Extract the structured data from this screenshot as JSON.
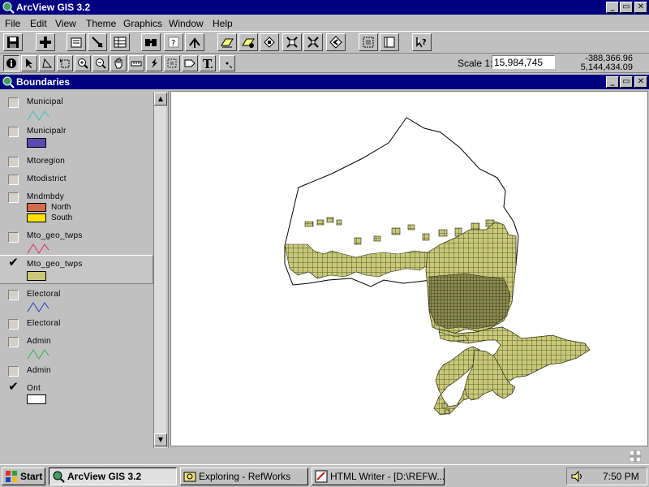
{
  "app": {
    "title": "ArcView GIS 3.2",
    "window_buttons": [
      "_",
      "▭",
      "✕"
    ]
  },
  "menu": {
    "items": [
      {
        "label": "File"
      },
      {
        "label": "Edit"
      },
      {
        "label": "View"
      },
      {
        "label": "Theme"
      },
      {
        "label": "Graphics"
      },
      {
        "label": "Window"
      },
      {
        "label": "Help"
      }
    ]
  },
  "toolbar": {
    "buttons": [
      "save-icon",
      "add-theme-icon",
      "theme-properties-icon",
      "edit-legend-icon",
      "open-table-icon",
      "find-icon",
      "query-builder-icon",
      "locate-address-icon",
      "select-all-icon",
      "select-by-theme-icon",
      "zoom-selected-icon",
      "clear-selection-icon",
      "zoom-full-extent-icon",
      "zoom-to-themes-icon",
      "zoom-previous-icon",
      "layout-icon",
      "help-icon"
    ]
  },
  "tools": {
    "items": [
      "identify-icon",
      "pointer-icon",
      "vertex-edit-icon",
      "select-feature-icon",
      "zoom-in-icon",
      "zoom-out-icon",
      "pan-icon",
      "measure-icon",
      "hotlink-icon",
      "area-of-interest-icon",
      "label-icon",
      "text-icon",
      "draw-point-icon"
    ],
    "scale_label": "Scale 1:",
    "scale_value": "15,984,745",
    "coord_x": "-388,366.96",
    "coord_y": "5,144,434.09"
  },
  "view": {
    "title": "Boundaries"
  },
  "toc": {
    "themes": [
      {
        "name": "Municipal",
        "checked": false,
        "symbol": "line",
        "color": "#40c0c0"
      },
      {
        "name": "Municipalr",
        "checked": false,
        "symbol": "fill",
        "color": "#5b4bb0"
      },
      {
        "name": "Mtoregion",
        "checked": false,
        "symbol": "none"
      },
      {
        "name": "Mtodistrict",
        "checked": false,
        "symbol": "none"
      },
      {
        "name": "Mndmbdy",
        "checked": false,
        "symbol": "classes",
        "classes": [
          {
            "label": "North",
            "color": "#d46a4a"
          },
          {
            "label": "South",
            "color": "#ffe000"
          }
        ]
      },
      {
        "name": "Mto_geo_twps",
        "checked": false,
        "symbol": "line",
        "color": "#d0306a"
      },
      {
        "name": "Mto_geo_twps",
        "checked": true,
        "symbol": "fill",
        "color": "#c8c878",
        "selected": true
      },
      {
        "name": "Electoral",
        "checked": false,
        "symbol": "line",
        "color": "#2040c0"
      },
      {
        "name": "Electoral",
        "checked": false,
        "symbol": "none"
      },
      {
        "name": "Admin",
        "checked": false,
        "symbol": "line",
        "color": "#30b040"
      },
      {
        "name": "Admin",
        "checked": false,
        "symbol": "none"
      },
      {
        "name": "Ont",
        "checked": true,
        "symbol": "fill",
        "color": "#ffffff"
      }
    ]
  },
  "taskbar": {
    "start_label": "Start",
    "tasks": [
      {
        "label": "ArcView GIS 3.2",
        "active": true
      },
      {
        "label": "Exploring - RefWorks",
        "active": false
      },
      {
        "label": "HTML Writer - [D:\\REFW...",
        "active": false
      }
    ],
    "clock": "7:50 PM"
  },
  "colors": {
    "titlebar": "#000080",
    "face": "#c0c0c0",
    "township_fill": "#c8c878"
  }
}
